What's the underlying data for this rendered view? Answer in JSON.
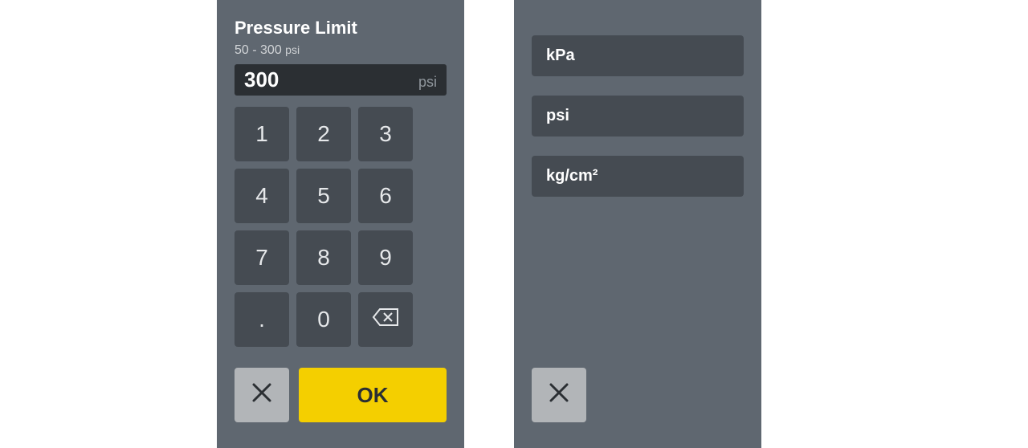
{
  "left": {
    "title": "Pressure Limit",
    "range_text": "50 - 300",
    "range_unit": "psi",
    "value": "300",
    "value_unit": "psi",
    "keys": [
      "1",
      "2",
      "3",
      "4",
      "5",
      "6",
      "7",
      "8",
      "9",
      ".",
      "0"
    ],
    "ok_label": "OK"
  },
  "right": {
    "units": [
      "kPa",
      "psi",
      "kg/cm²"
    ]
  },
  "colors": {
    "panel_bg": "#5f6770",
    "key_bg": "#454b52",
    "ok_bg": "#f4cf00",
    "cancel_bg": "#b2b5b8",
    "value_bg": "#2b2f33"
  }
}
